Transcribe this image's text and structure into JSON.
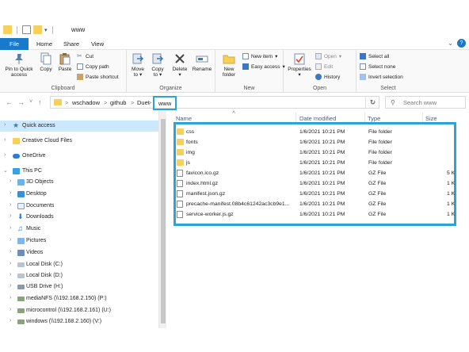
{
  "window": {
    "title": "www"
  },
  "tabs": [
    {
      "label": "File"
    },
    {
      "label": "Home"
    },
    {
      "label": "Share"
    },
    {
      "label": "View"
    }
  ],
  "ribbon": {
    "clipboard": {
      "pin_label": "Pin to Quick access",
      "copy_label": "Copy",
      "paste_label": "Paste",
      "cut_label": "Cut",
      "copy_path_label": "Copy path",
      "paste_shortcut_label": "Paste shortcut",
      "group_label": "Clipboard"
    },
    "organize": {
      "move_to_label": "Move to",
      "copy_to_label": "Copy to",
      "delete_label": "Delete",
      "rename_label": "Rename",
      "group_label": "Organize"
    },
    "new": {
      "new_folder_label": "New folder",
      "new_item_label": "New item",
      "easy_access_label": "Easy access",
      "group_label": "New"
    },
    "open": {
      "properties_label": "Properties",
      "open_label": "Open",
      "edit_label": "Edit",
      "history_label": "History",
      "group_label": "Open"
    },
    "select": {
      "select_all_label": "Select all",
      "select_none_label": "Select none",
      "invert_label": "Invert selection",
      "group_label": "Select"
    }
  },
  "address": {
    "back_icon": "←",
    "forward_icon": "→",
    "up_icon": "↑",
    "recent_icon": "˅",
    "crumb_sep": ">",
    "crumbs": [
      "wschadow",
      "github",
      "Duet",
      "www"
    ],
    "refresh_icon": "↻",
    "search_placeholder": "Search www"
  },
  "nav": {
    "items": [
      {
        "label": "Quick access"
      },
      {
        "label": "Creative Cloud Files"
      },
      {
        "label": "OneDrive"
      },
      {
        "label": "This PC"
      },
      {
        "label": "3D Objects"
      },
      {
        "label": "Desktop"
      },
      {
        "label": "Documents"
      },
      {
        "label": "Downloads"
      },
      {
        "label": "Music"
      },
      {
        "label": "Pictures"
      },
      {
        "label": "Videos"
      },
      {
        "label": "Local Disk (C:)"
      },
      {
        "label": "Local Disk (D:)"
      },
      {
        "label": "USB Drive (H:)"
      },
      {
        "label": "mediaNFS (\\\\192.168.2.150) (P:)"
      },
      {
        "label": "microcontrol (\\\\192.168.2.161) (U:)"
      },
      {
        "label": "windows (\\\\192.168.2.160) (V:)"
      }
    ]
  },
  "columns": {
    "name": "Name",
    "date": "Date modified",
    "type": "Type",
    "size": "Size"
  },
  "files": [
    {
      "name": "css",
      "date": "1/6/2021 10:21 PM",
      "type": "File folder",
      "size": ""
    },
    {
      "name": "fonts",
      "date": "1/6/2021 10:21 PM",
      "type": "File folder",
      "size": ""
    },
    {
      "name": "img",
      "date": "1/6/2021 10:21 PM",
      "type": "File folder",
      "size": ""
    },
    {
      "name": "js",
      "date": "1/6/2021 10:21 PM",
      "type": "File folder",
      "size": ""
    },
    {
      "name": "favicon.ico.gz",
      "date": "1/6/2021 10:21 PM",
      "type": "GZ File",
      "size": "5 K"
    },
    {
      "name": "index.html.gz",
      "date": "1/6/2021 10:21 PM",
      "type": "GZ File",
      "size": "1 K"
    },
    {
      "name": "manifest.json.gz",
      "date": "1/6/2021 10:21 PM",
      "type": "GZ File",
      "size": "1 K"
    },
    {
      "name": "precache-manifest.08b4c61242ac3cb9e1...",
      "date": "1/6/2021 10:21 PM",
      "type": "GZ File",
      "size": "1 K"
    },
    {
      "name": "service-worker.js.gz",
      "date": "1/6/2021 10:21 PM",
      "type": "GZ File",
      "size": "1 K"
    }
  ],
  "colors": {
    "accent": "#1979ca",
    "highlight": "#2aa3d7",
    "folder": "#f7cf5b"
  }
}
